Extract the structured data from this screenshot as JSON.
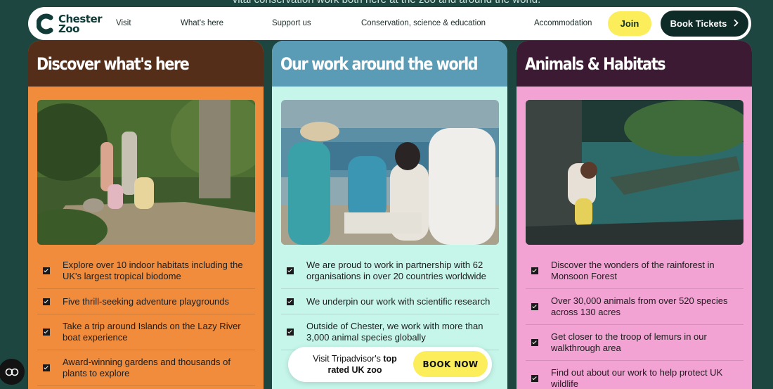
{
  "top_banner": "vital conservation work both here at the zoo and around the world.",
  "logo": {
    "line1": "Chester",
    "line2": "Zoo"
  },
  "nav": {
    "items": [
      "Visit",
      "What's here",
      "Support us",
      "Conservation, science & education",
      "Accommodation"
    ],
    "join": "Join",
    "book": "Book Tickets"
  },
  "cards": [
    {
      "title": "Discover what's here",
      "items": [
        "Explore over 10 indoor habitats including the UK's largest tropical biodome",
        "Five thrill-seeking adventure playgrounds",
        "Take a trip around Islands on the Lazy River boat experience",
        "Award-winning gardens and thousands of plants to explore"
      ]
    },
    {
      "title": "Our work around the world",
      "items": [
        "We are proud to work in partnership with 62 organisations in over 20 countries worldwide",
        "We underpin our work with scientific research",
        "Outside of Chester, we work with more than 3,000 animal species globally"
      ]
    },
    {
      "title": "Animals & Habitats",
      "items": [
        "Discover the wonders of the rainforest in Monsoon Forest",
        "Over 30,000 animals from over 520 species across 130 acres",
        "Get closer to the troop of lemurs in our walkthrough area",
        "Find out about our work to help protect UK wildlife"
      ]
    }
  ],
  "tripadvisor": {
    "text_pre": "Visit Tripadvisor's ",
    "text_bold": "top rated UK zoo",
    "button": "BOOK NOW"
  },
  "colors": {
    "page_bg": "#1e4640",
    "card1": "#f08c3c",
    "card1_head": "#552e1a",
    "card2": "#c6f6ea",
    "card2_head": "#5a9cb6",
    "card3": "#f2a2d3",
    "card3_head": "#3d1a33",
    "accent_yellow": "#fbee5a"
  }
}
